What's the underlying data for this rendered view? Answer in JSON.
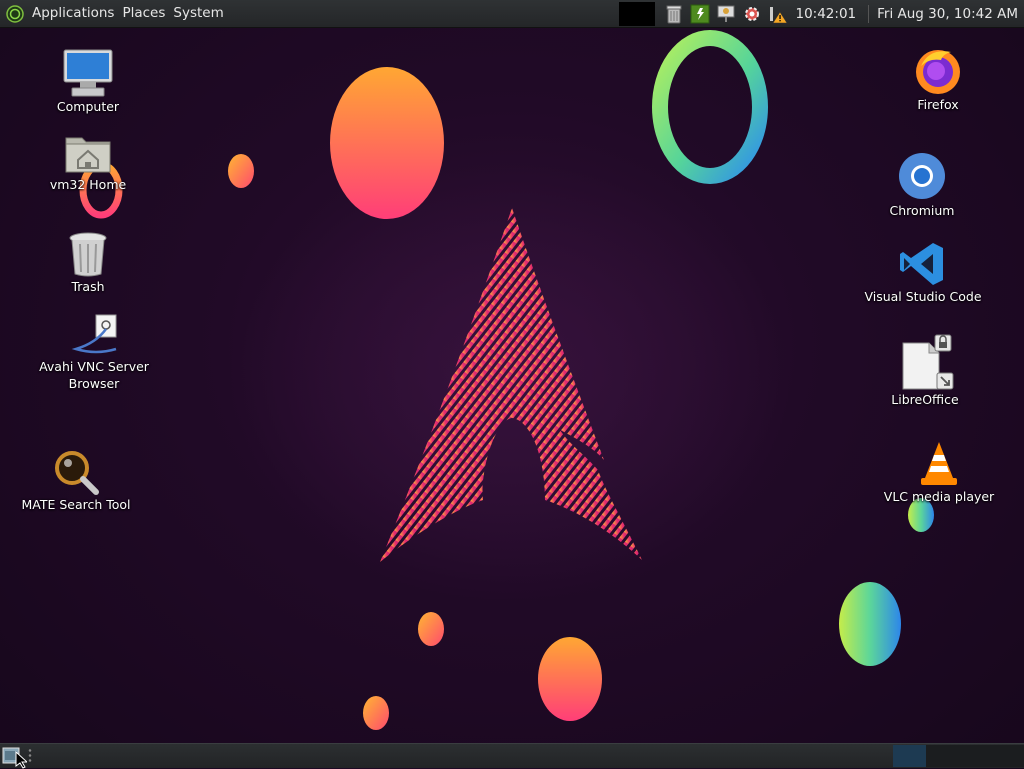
{
  "top_panel": {
    "menus": [
      "Applications",
      "Places",
      "System"
    ],
    "clock_time": "10:42:01",
    "clock_datetime": "Fri Aug 30, 10:42 AM"
  },
  "desktop_left": [
    {
      "label": "Computer",
      "icon": "computer-icon"
    },
    {
      "label": "vm32 Home",
      "icon": "home-folder-icon"
    },
    {
      "label": "Trash",
      "icon": "trash-icon"
    },
    {
      "label": "Avahi VNC Server Browser",
      "icon": "vnc-browser-icon"
    },
    {
      "label": "MATE Search Tool",
      "icon": "search-tool-icon"
    }
  ],
  "desktop_right": [
    {
      "label": "Firefox",
      "icon": "firefox-icon"
    },
    {
      "label": "Chromium",
      "icon": "chromium-icon"
    },
    {
      "label": "Visual Studio Code",
      "icon": "vscode-icon"
    },
    {
      "label": "LibreOffice",
      "icon": "libreoffice-icon"
    },
    {
      "label": "VLC media player",
      "icon": "vlc-icon"
    }
  ],
  "colors": {
    "panel": "#2a2c2e",
    "desktop_bg": "#210a27",
    "accent_pink": "#e9356e",
    "accent_orange": "#fc8c3b"
  }
}
